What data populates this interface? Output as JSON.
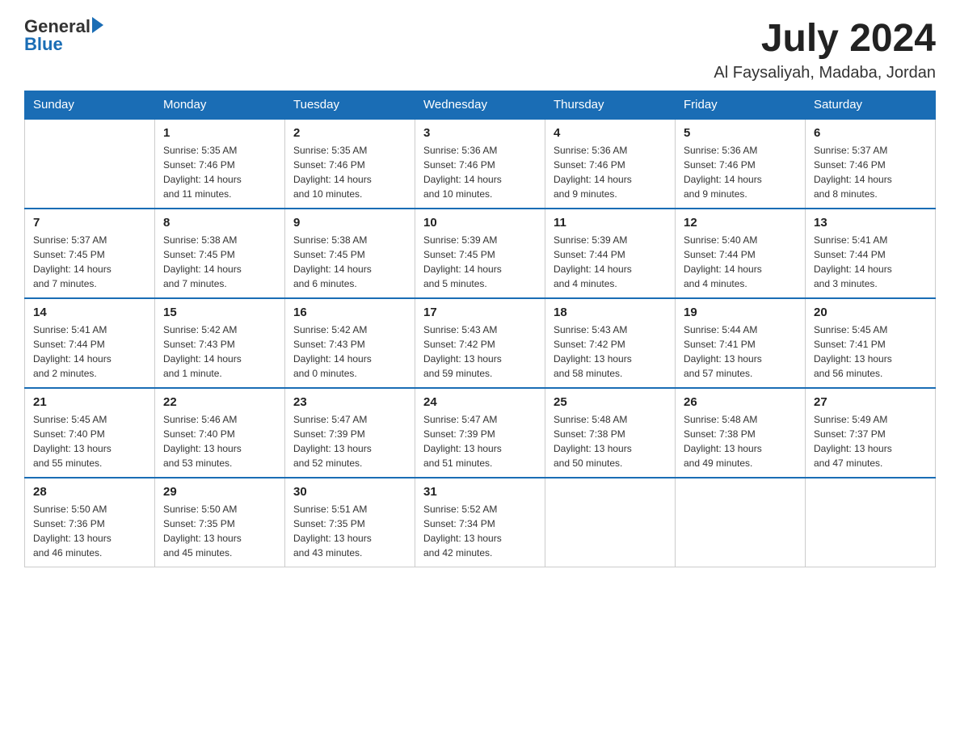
{
  "header": {
    "logo_text_general": "General",
    "logo_text_blue": "Blue",
    "month_title": "July 2024",
    "location": "Al Faysaliyah, Madaba, Jordan"
  },
  "days_of_week": [
    "Sunday",
    "Monday",
    "Tuesday",
    "Wednesday",
    "Thursday",
    "Friday",
    "Saturday"
  ],
  "weeks": [
    [
      {
        "day": "",
        "info": ""
      },
      {
        "day": "1",
        "info": "Sunrise: 5:35 AM\nSunset: 7:46 PM\nDaylight: 14 hours\nand 11 minutes."
      },
      {
        "day": "2",
        "info": "Sunrise: 5:35 AM\nSunset: 7:46 PM\nDaylight: 14 hours\nand 10 minutes."
      },
      {
        "day": "3",
        "info": "Sunrise: 5:36 AM\nSunset: 7:46 PM\nDaylight: 14 hours\nand 10 minutes."
      },
      {
        "day": "4",
        "info": "Sunrise: 5:36 AM\nSunset: 7:46 PM\nDaylight: 14 hours\nand 9 minutes."
      },
      {
        "day": "5",
        "info": "Sunrise: 5:36 AM\nSunset: 7:46 PM\nDaylight: 14 hours\nand 9 minutes."
      },
      {
        "day": "6",
        "info": "Sunrise: 5:37 AM\nSunset: 7:46 PM\nDaylight: 14 hours\nand 8 minutes."
      }
    ],
    [
      {
        "day": "7",
        "info": "Sunrise: 5:37 AM\nSunset: 7:45 PM\nDaylight: 14 hours\nand 7 minutes."
      },
      {
        "day": "8",
        "info": "Sunrise: 5:38 AM\nSunset: 7:45 PM\nDaylight: 14 hours\nand 7 minutes."
      },
      {
        "day": "9",
        "info": "Sunrise: 5:38 AM\nSunset: 7:45 PM\nDaylight: 14 hours\nand 6 minutes."
      },
      {
        "day": "10",
        "info": "Sunrise: 5:39 AM\nSunset: 7:45 PM\nDaylight: 14 hours\nand 5 minutes."
      },
      {
        "day": "11",
        "info": "Sunrise: 5:39 AM\nSunset: 7:44 PM\nDaylight: 14 hours\nand 4 minutes."
      },
      {
        "day": "12",
        "info": "Sunrise: 5:40 AM\nSunset: 7:44 PM\nDaylight: 14 hours\nand 4 minutes."
      },
      {
        "day": "13",
        "info": "Sunrise: 5:41 AM\nSunset: 7:44 PM\nDaylight: 14 hours\nand 3 minutes."
      }
    ],
    [
      {
        "day": "14",
        "info": "Sunrise: 5:41 AM\nSunset: 7:44 PM\nDaylight: 14 hours\nand 2 minutes."
      },
      {
        "day": "15",
        "info": "Sunrise: 5:42 AM\nSunset: 7:43 PM\nDaylight: 14 hours\nand 1 minute."
      },
      {
        "day": "16",
        "info": "Sunrise: 5:42 AM\nSunset: 7:43 PM\nDaylight: 14 hours\nand 0 minutes."
      },
      {
        "day": "17",
        "info": "Sunrise: 5:43 AM\nSunset: 7:42 PM\nDaylight: 13 hours\nand 59 minutes."
      },
      {
        "day": "18",
        "info": "Sunrise: 5:43 AM\nSunset: 7:42 PM\nDaylight: 13 hours\nand 58 minutes."
      },
      {
        "day": "19",
        "info": "Sunrise: 5:44 AM\nSunset: 7:41 PM\nDaylight: 13 hours\nand 57 minutes."
      },
      {
        "day": "20",
        "info": "Sunrise: 5:45 AM\nSunset: 7:41 PM\nDaylight: 13 hours\nand 56 minutes."
      }
    ],
    [
      {
        "day": "21",
        "info": "Sunrise: 5:45 AM\nSunset: 7:40 PM\nDaylight: 13 hours\nand 55 minutes."
      },
      {
        "day": "22",
        "info": "Sunrise: 5:46 AM\nSunset: 7:40 PM\nDaylight: 13 hours\nand 53 minutes."
      },
      {
        "day": "23",
        "info": "Sunrise: 5:47 AM\nSunset: 7:39 PM\nDaylight: 13 hours\nand 52 minutes."
      },
      {
        "day": "24",
        "info": "Sunrise: 5:47 AM\nSunset: 7:39 PM\nDaylight: 13 hours\nand 51 minutes."
      },
      {
        "day": "25",
        "info": "Sunrise: 5:48 AM\nSunset: 7:38 PM\nDaylight: 13 hours\nand 50 minutes."
      },
      {
        "day": "26",
        "info": "Sunrise: 5:48 AM\nSunset: 7:38 PM\nDaylight: 13 hours\nand 49 minutes."
      },
      {
        "day": "27",
        "info": "Sunrise: 5:49 AM\nSunset: 7:37 PM\nDaylight: 13 hours\nand 47 minutes."
      }
    ],
    [
      {
        "day": "28",
        "info": "Sunrise: 5:50 AM\nSunset: 7:36 PM\nDaylight: 13 hours\nand 46 minutes."
      },
      {
        "day": "29",
        "info": "Sunrise: 5:50 AM\nSunset: 7:35 PM\nDaylight: 13 hours\nand 45 minutes."
      },
      {
        "day": "30",
        "info": "Sunrise: 5:51 AM\nSunset: 7:35 PM\nDaylight: 13 hours\nand 43 minutes."
      },
      {
        "day": "31",
        "info": "Sunrise: 5:52 AM\nSunset: 7:34 PM\nDaylight: 13 hours\nand 42 minutes."
      },
      {
        "day": "",
        "info": ""
      },
      {
        "day": "",
        "info": ""
      },
      {
        "day": "",
        "info": ""
      }
    ]
  ]
}
